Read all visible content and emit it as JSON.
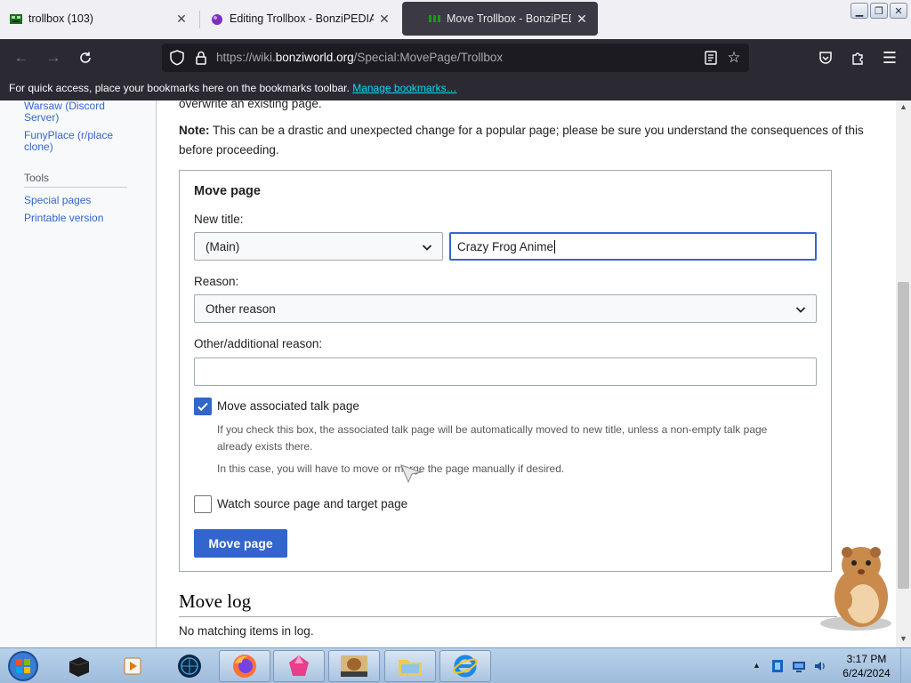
{
  "tabs": [
    {
      "title": "trollbox (103)",
      "close": "✕"
    },
    {
      "title": "Editing Trollbox - BonziPEDIA",
      "close": "✕"
    },
    {
      "title": "Move Trollbox - BonziPEDIA",
      "close": "✕"
    }
  ],
  "url": {
    "prefix": "https://wiki.",
    "domain": "bonziworld.org",
    "path": "/Special:MovePage/Trollbox"
  },
  "bookmarks": {
    "text": "For quick access, place your bookmarks here on the bookmarks toolbar.",
    "link": "Manage bookmarks…"
  },
  "sidebar": {
    "links": [
      "Warsaw (Discord",
      "Server)",
      "FunyPlace (r/place",
      "clone)"
    ],
    "tools_heading": "Tools",
    "tools": [
      "Special pages",
      "Printable version"
    ]
  },
  "content": {
    "cut_line": "overwrite an existing page.",
    "note_label": "Note:",
    "note_text": " This can be a drastic and unexpected change for a popular page; please be sure you understand the consequences of this before proceeding."
  },
  "form": {
    "legend": "Move page",
    "new_title_label": "New title:",
    "namespace": "(Main)",
    "title_value": "Crazy Frog Anime",
    "reason_label": "Reason:",
    "reason": "Other reason",
    "other_reason_label": "Other/additional reason:",
    "other_reason_value": "",
    "talk_label": "Move associated talk page",
    "talk_checked": true,
    "talk_help1": "If you check this box, the associated talk page will be automatically moved to new title, unless a non-empty talk page already exists there.",
    "talk_help2": "In this case, you will have to move or merge the page manually if desired.",
    "watch_label": "Watch source page and target page",
    "watch_checked": false,
    "submit": "Move page"
  },
  "move_log": {
    "heading": "Move log",
    "text": "No matching items in log."
  },
  "clock": {
    "time": "3:17 PM",
    "date": "6/24/2024"
  },
  "colors": {
    "link": "#3366cc",
    "primary_button": "#3366cc",
    "toolbar": "#2b2a33"
  }
}
